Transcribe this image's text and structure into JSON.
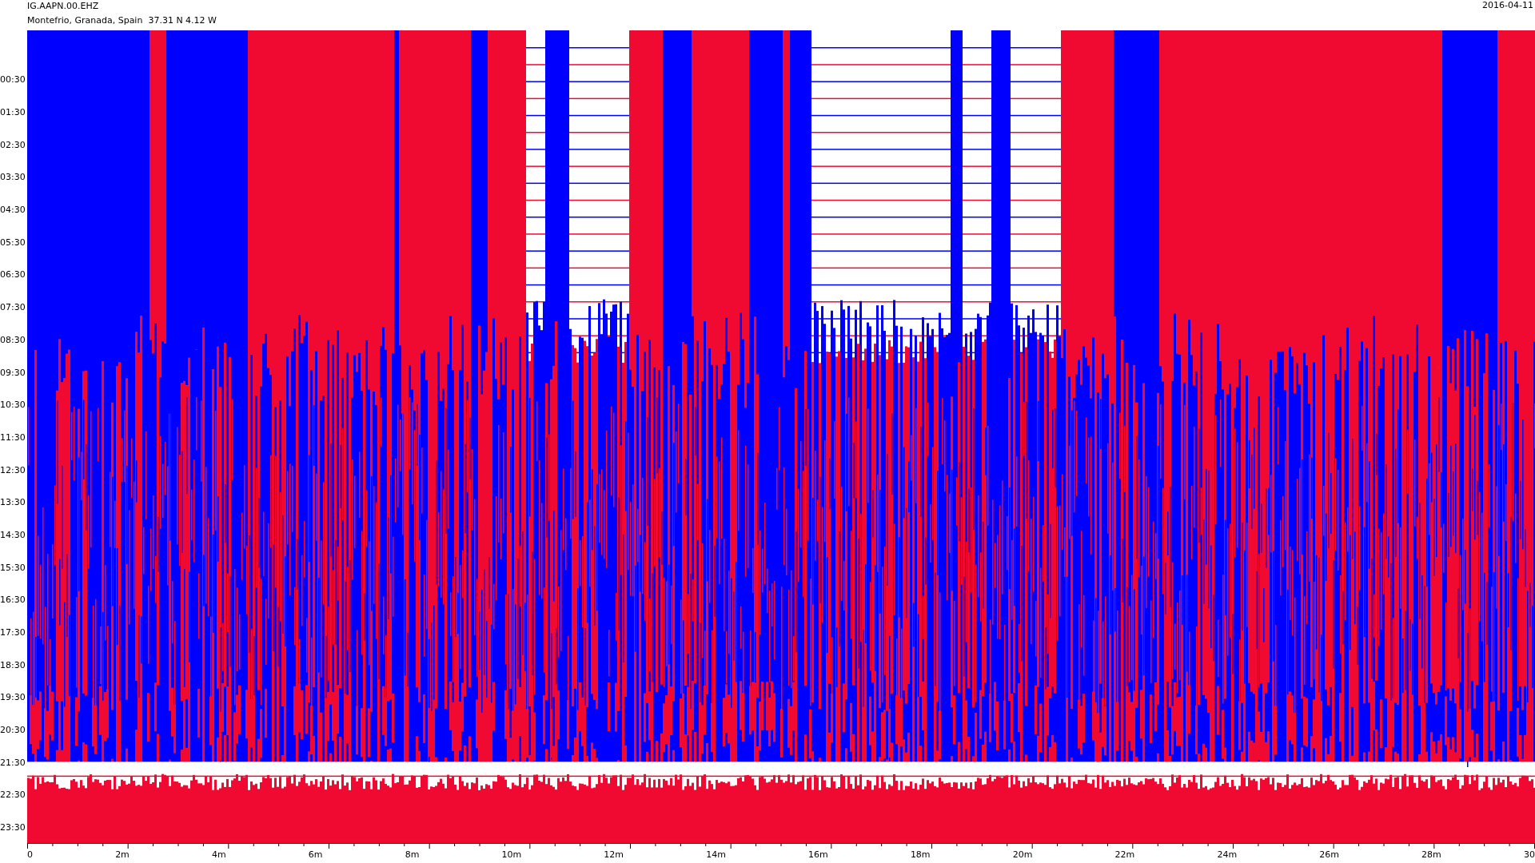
{
  "header": {
    "station": "IG.AAPN.00.EHZ",
    "location": "Montefrio, Granada, Spain  37.31 N 4.12 W",
    "date": "2016-04-11"
  },
  "time_labels": [
    "00:30",
    "01:30",
    "02:30",
    "03:30",
    "04:30",
    "05:30",
    "06:30",
    "07:30",
    "08:30",
    "09:30",
    "10:30",
    "11:30",
    "12:30",
    "13:30",
    "14:30",
    "15:30",
    "16:30",
    "17:30",
    "18:30",
    "19:30",
    "20:30",
    "21:30",
    "22:30",
    "23:30"
  ],
  "minute_labels": [
    "0",
    "2m",
    "4m",
    "6m",
    "8m",
    "10m",
    "12m",
    "14m",
    "16m",
    "18m",
    "20m",
    "22m",
    "24m",
    "26m",
    "28m",
    "30"
  ]
}
